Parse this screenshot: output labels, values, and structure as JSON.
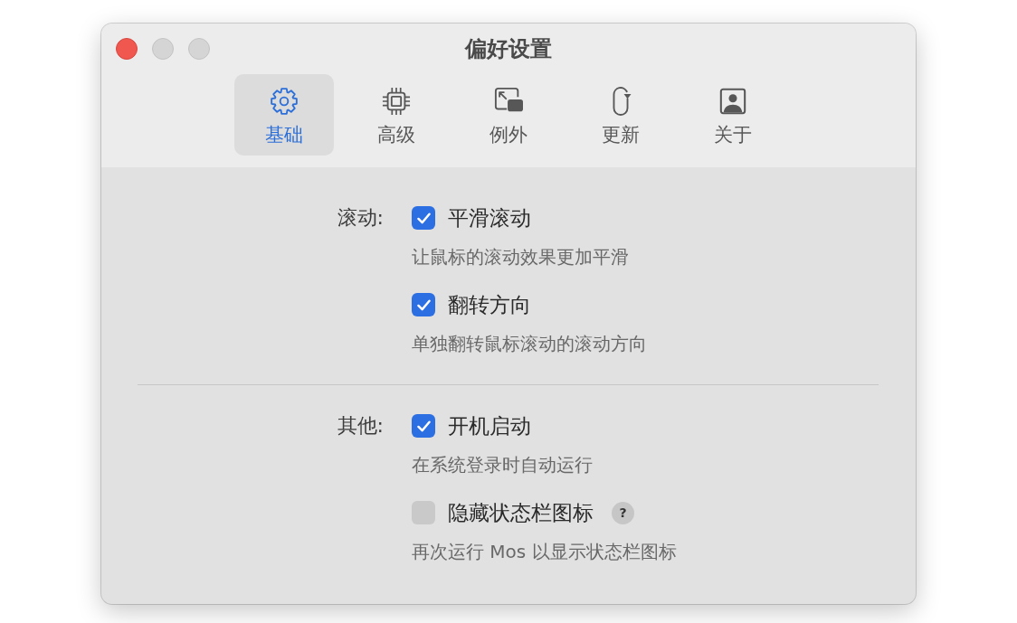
{
  "window": {
    "title": "偏好设置"
  },
  "window_controls": [
    {
      "kind": "close",
      "disabled": false
    },
    {
      "kind": "minimize",
      "disabled": true
    },
    {
      "kind": "zoom",
      "disabled": true
    }
  ],
  "tabs": [
    {
      "label": "基础",
      "selected": true
    },
    {
      "label": "高级",
      "selected": false
    },
    {
      "label": "例外",
      "selected": false
    },
    {
      "label": "更新",
      "selected": false
    },
    {
      "label": "关于",
      "selected": false
    }
  ],
  "sections": [
    {
      "label": "滚动:",
      "options": [
        {
          "label": "平滑滚动",
          "checked": true,
          "description": "让鼠标的滚动效果更加平滑"
        },
        {
          "label": "翻转方向",
          "checked": true,
          "description": "单独翻转鼠标滚动的滚动方向"
        }
      ]
    },
    {
      "label": "其他:",
      "options": [
        {
          "label": "开机启动",
          "checked": true,
          "description": "在系统登录时自动运行"
        },
        {
          "label": "隐藏状态栏图标",
          "checked": false,
          "help": "?",
          "description": "再次运行 Mos 以显示状态栏图标"
        }
      ]
    }
  ]
}
